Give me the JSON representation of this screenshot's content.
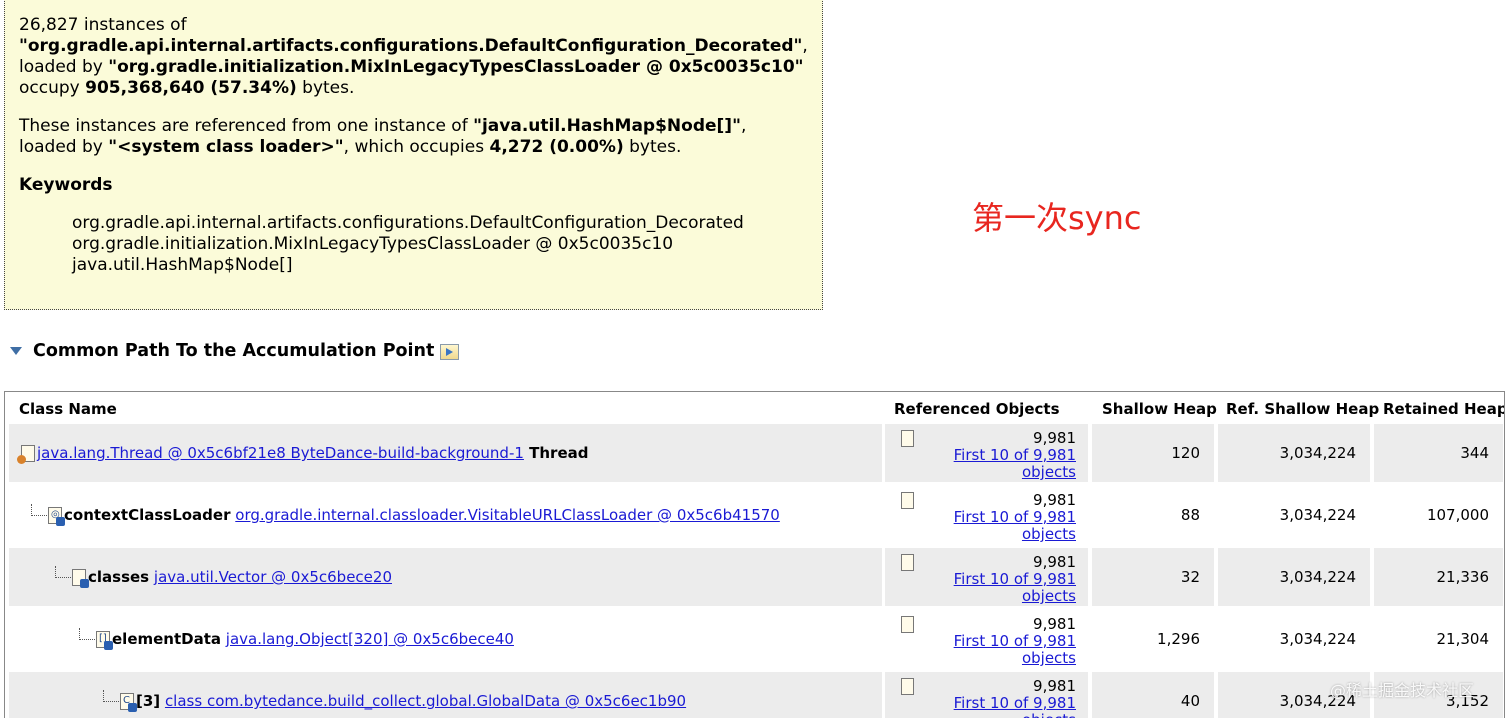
{
  "summary": {
    "p1_count": "26,827 instances of",
    "p1_class": "\"org.gradle.api.internal.artifacts.configurations.DefaultConfiguration_Decorated\"",
    "p1_comma": ",",
    "p1_loaded": "loaded by ",
    "p1_loader": "\"org.gradle.initialization.MixInLegacyTypesClassLoader @ 0x5c0035c10\"",
    "p1_occupy": " occupy ",
    "p1_bytes_val": "905,368,640 (57.34%)",
    "p1_bytes": " bytes.",
    "p2_prefix": "These instances are referenced from one instance of ",
    "p2_class": "\"java.util.HashMap$Node[]\"",
    "p2_loaded": ", loaded by ",
    "p2_loader": "\"<system class loader>\"",
    "p2_which": ", which occupies ",
    "p2_val": "4,272 (0.00%)",
    "p2_bytes": " bytes.",
    "keywords_title": "Keywords",
    "keywords": [
      "org.gradle.api.internal.artifacts.configurations.DefaultConfiguration_Decorated",
      "org.gradle.initialization.MixInLegacyTypesClassLoader @ 0x5c0035c10",
      "java.util.HashMap$Node[]"
    ]
  },
  "annotation": "第一次sync",
  "section": {
    "title": "Common Path To the Accumulation Point"
  },
  "table": {
    "headers": {
      "class_name": "Class Name",
      "ref_objects": "Referenced Objects",
      "shallow": "Shallow Heap",
      "ref_shallow": "Ref. Shallow Heap",
      "retained": "Retained Heap"
    },
    "rows": [
      {
        "field": "",
        "link": "java.lang.Thread @ 0x5c6bf21e8 ByteDance-build-background-1",
        "suffix": " Thread",
        "ref_count": "9,981",
        "ref_link_1": "First 10 of 9,981",
        "ref_link_2": "objects",
        "shallow": "120",
        "ref_shallow": "3,034,224",
        "retained": "344",
        "icon": "thread-icon",
        "glyph": ""
      },
      {
        "field": "contextClassLoader",
        "link": "org.gradle.internal.classloader.VisitableURLClassLoader @ 0x5c6b41570",
        "suffix": "",
        "ref_count": "9,981",
        "ref_link_1": "First 10 of 9,981",
        "ref_link_2": "objects",
        "shallow": "88",
        "ref_shallow": "3,034,224",
        "retained": "107,000",
        "icon": "classloader-icon",
        "glyph": "◎"
      },
      {
        "field": "classes",
        "link": "java.util.Vector @ 0x5c6bece20",
        "suffix": "",
        "ref_count": "9,981",
        "ref_link_1": "First 10 of 9,981",
        "ref_link_2": "objects",
        "shallow": "32",
        "ref_shallow": "3,034,224",
        "retained": "21,336",
        "icon": "object-icon",
        "glyph": ""
      },
      {
        "field": "elementData",
        "link": "java.lang.Object[320] @ 0x5c6bece40",
        "suffix": "",
        "ref_count": "9,981",
        "ref_link_1": "First 10 of 9,981",
        "ref_link_2": "objects",
        "shallow": "1,296",
        "ref_shallow": "3,034,224",
        "retained": "21,304",
        "icon": "array-icon",
        "glyph": "[]"
      },
      {
        "field": "[3]",
        "link": "class com.bytedance.build_collect.global.GlobalData @ 0x5c6ec1b90",
        "suffix": "",
        "ref_count": "9,981",
        "ref_link_1": "First 10 of 9,981",
        "ref_link_2": "objects",
        "shallow": "40",
        "ref_shallow": "3,034,224",
        "retained": "3,152",
        "icon": "class-icon",
        "glyph": "C"
      }
    ]
  },
  "watermark": "@稀土掘金技术社区"
}
